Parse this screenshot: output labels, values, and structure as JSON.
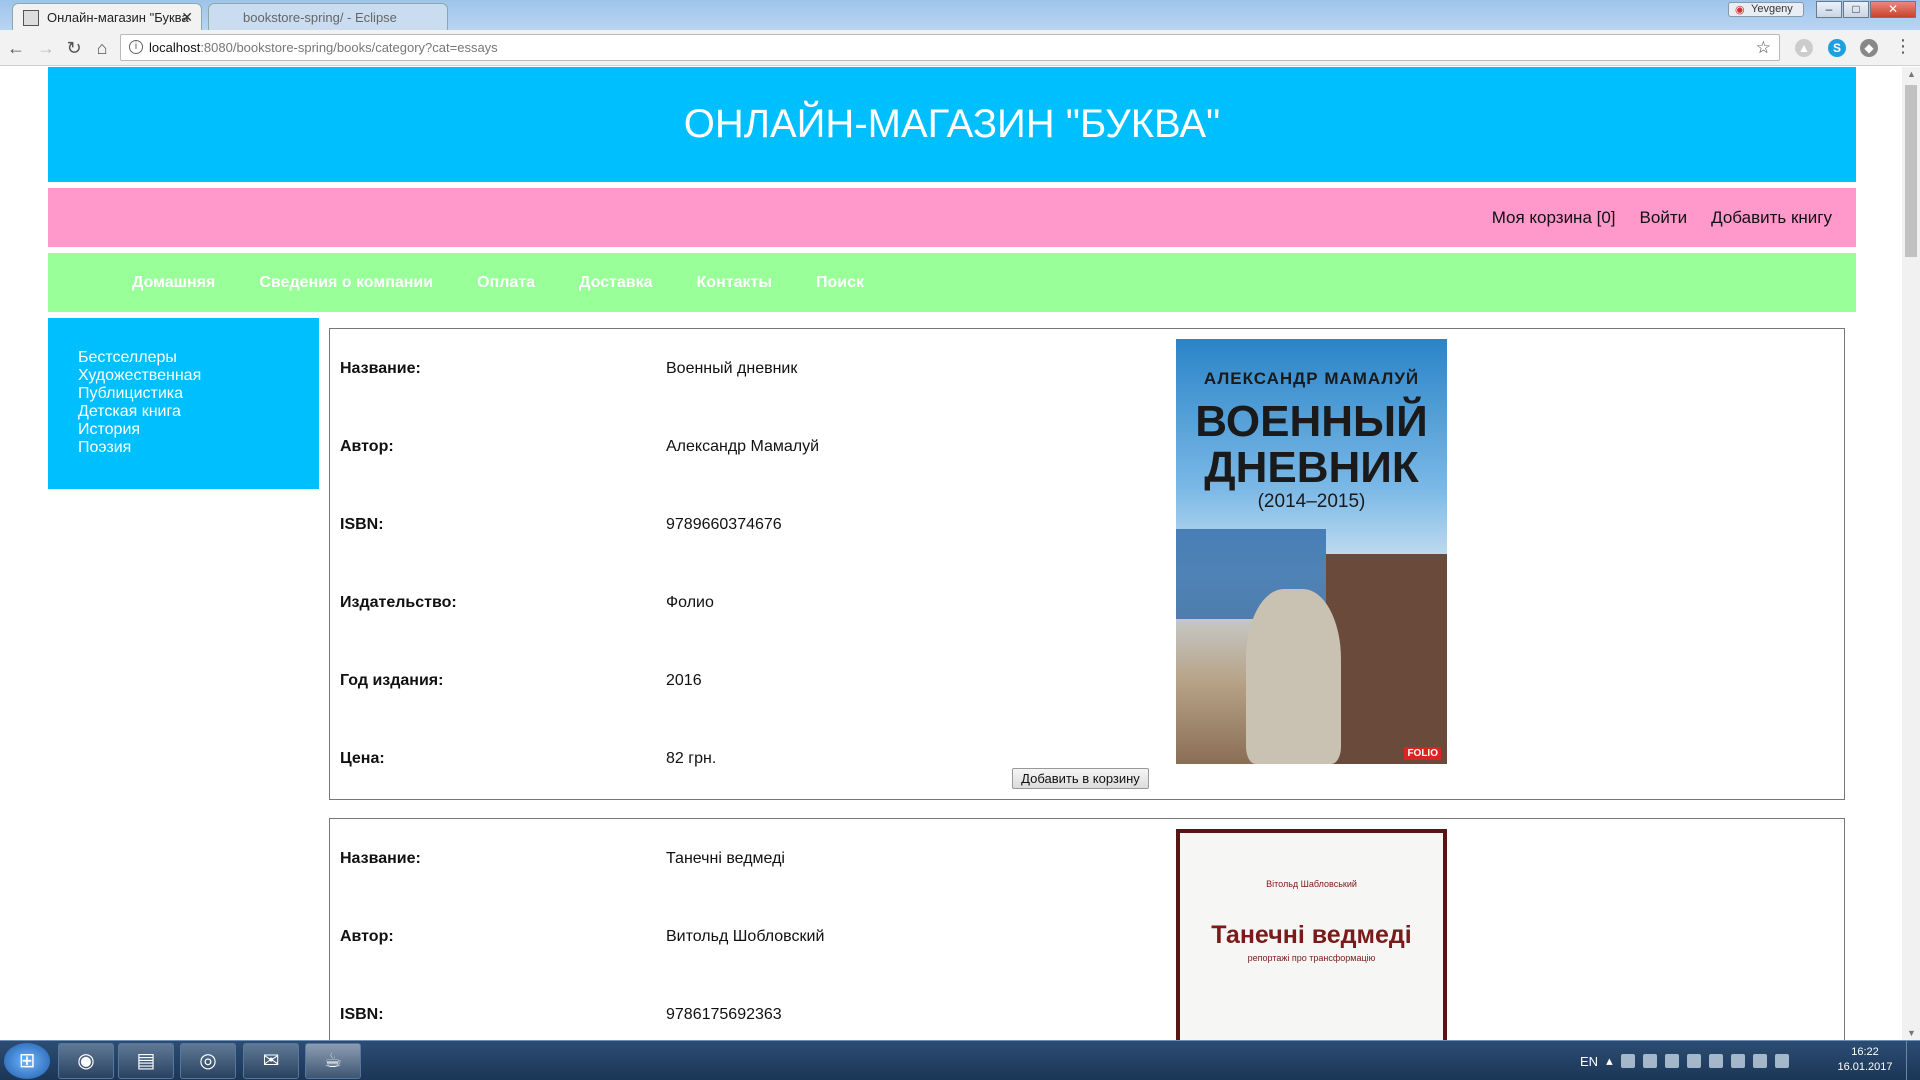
{
  "browser": {
    "active_tab_title": "Онлайн-магазин \"Буква",
    "inactive_tab_title": "bookstore-spring/ - Eclipse",
    "profile_name": "Yevgeny",
    "url_host": "localhost",
    "url_path": ":8080/bookstore-spring/books/category?cat=essays"
  },
  "site": {
    "title": "ОНЛАЙН-МАГАЗИН \"БУКВА\"",
    "user_links": {
      "cart": "Моя корзина [0]",
      "login": "Войти",
      "add_book": "Добавить книгу"
    },
    "nav": [
      "Домашняя",
      "Сведения о компании",
      "Оплата",
      "Доставка",
      "Контакты",
      "Поиск"
    ],
    "categories": [
      "Бестселлеры",
      "Художественная",
      "Публицистика",
      "Детская книга",
      "История",
      "Поэзия"
    ]
  },
  "labels": {
    "title": "Название:",
    "author": "Автор:",
    "isbn": "ISBN:",
    "publisher": "Издательство:",
    "year": "Год издания:",
    "price": "Цена:",
    "add_to_cart": "Добавить в корзину"
  },
  "books": [
    {
      "title": "Военный дневник",
      "author": "Александр Мамалуй",
      "isbn": "9789660374676",
      "publisher": "Фолио",
      "year": "2016",
      "price": "82 грн.",
      "cover": {
        "author": "АЛЕКСАНДР МАМАЛУЙ",
        "line1": "ВОЕННЫЙ",
        "line2": "ДНЕВНИК",
        "years": "(2014–2015)",
        "publisher_mark": "FOLIO"
      }
    },
    {
      "title": "Танечні ведмеді",
      "author": "Витольд Шобловский",
      "isbn": "9786175692363",
      "cover": {
        "author": "Вітольд Шабловський",
        "title": "Танечні ведмеді",
        "subtitle": "репортажі про трансформацію"
      }
    }
  ],
  "taskbar": {
    "lang": "EN",
    "time": "16:22",
    "date": "16.01.2017"
  }
}
